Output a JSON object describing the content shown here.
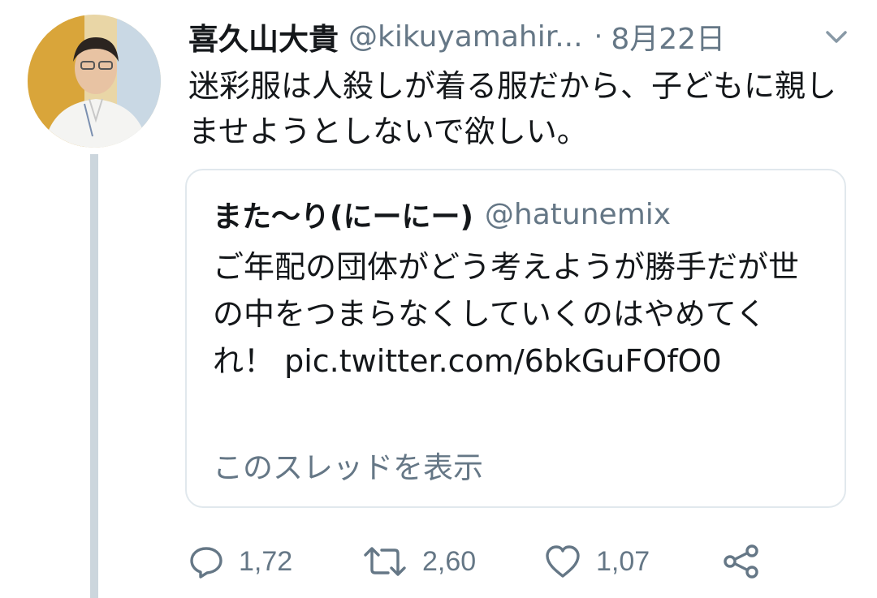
{
  "tweet": {
    "author_name": "喜久山大貴",
    "author_handle": "@kikuyamahir...",
    "separator": "·",
    "date": "8月22日",
    "text": "迷彩服は人殺しが着る服だから、子どもに親しませようとしないで欲しい。"
  },
  "quoted_tweet": {
    "author_name": "また〜り(にーにー)",
    "author_handle": "@hatunemix",
    "text": "ご年配の団体がどう考えようが勝手だが世の中をつまらなくしていくのはやめてくれ！ pic.twitter.com/6bkGuFOfO0",
    "show_thread_label": "このスレッドを表示"
  },
  "actions": {
    "reply_count": "1,72",
    "retweet_count": "2,60",
    "like_count": "1,07"
  },
  "icons": {
    "menu": "chevron-down-icon",
    "reply": "reply-icon",
    "retweet": "retweet-icon",
    "like": "heart-icon",
    "share": "share-icon"
  },
  "colors": {
    "text_primary": "#14171a",
    "text_secondary": "#657786",
    "border": "#e1e8ed",
    "thread_line": "#ccd6dd"
  }
}
